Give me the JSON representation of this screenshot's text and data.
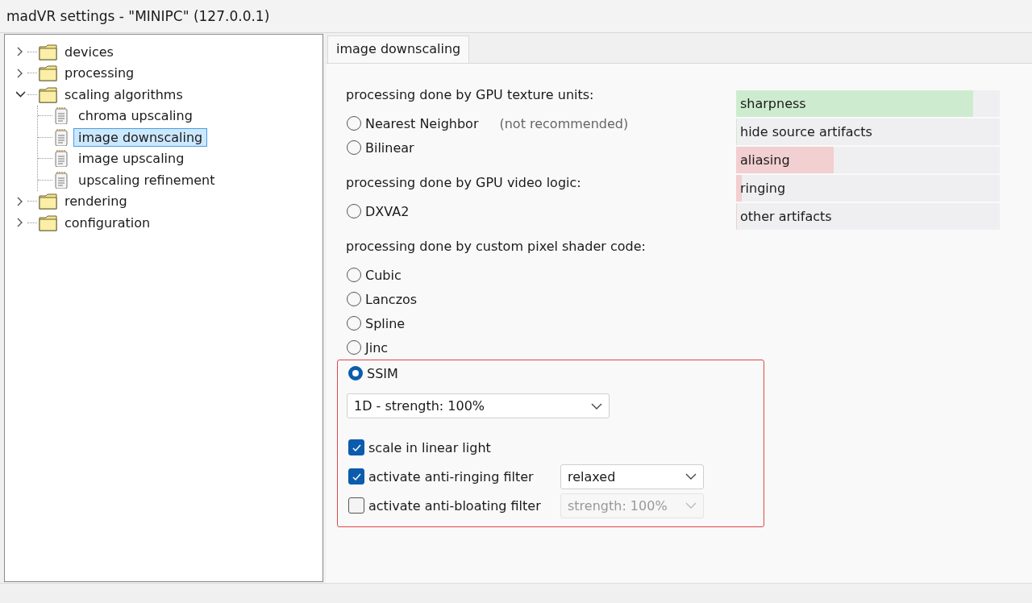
{
  "window": {
    "title": "madVR settings - \"MINIPC\" (127.0.0.1)"
  },
  "tree": [
    {
      "label": "devices",
      "kind": "folder",
      "expanded": false,
      "selected": false
    },
    {
      "label": "processing",
      "kind": "folder",
      "expanded": false,
      "selected": false
    },
    {
      "label": "scaling algorithms",
      "kind": "folder",
      "expanded": true,
      "selected": false,
      "children": [
        {
          "label": "chroma upscaling",
          "kind": "page",
          "selected": false
        },
        {
          "label": "image downscaling",
          "kind": "page",
          "selected": true
        },
        {
          "label": "image upscaling",
          "kind": "page",
          "selected": false
        },
        {
          "label": "upscaling refinement",
          "kind": "page",
          "selected": false
        }
      ]
    },
    {
      "label": "rendering",
      "kind": "folder",
      "expanded": false,
      "selected": false
    },
    {
      "label": "configuration",
      "kind": "folder",
      "expanded": false,
      "selected": false
    }
  ],
  "tabs": [
    {
      "label": "image downscaling",
      "selected": true
    }
  ],
  "groups": [
    {
      "heading": "processing done by GPU texture units:",
      "options": [
        {
          "label": "Nearest Neighbor",
          "note": "(not recommended)",
          "selected": false
        },
        {
          "label": "Bilinear",
          "selected": false
        }
      ]
    },
    {
      "heading": "processing done by GPU video logic:",
      "options": [
        {
          "label": "DXVA2",
          "selected": false
        }
      ]
    },
    {
      "heading": "processing done by custom pixel shader code:",
      "options": [
        {
          "label": "Cubic",
          "selected": false
        },
        {
          "label": "Lanczos",
          "selected": false
        },
        {
          "label": "Spline",
          "selected": false
        },
        {
          "label": "Jinc",
          "selected": false
        }
      ]
    }
  ],
  "ssim": {
    "highlighted": true,
    "option": {
      "label": "SSIM",
      "selected": true
    },
    "mode": {
      "value": "1D - strength: 100%"
    },
    "checkboxes": [
      {
        "label": "scale in linear light",
        "checked": true
      },
      {
        "label": "activate anti-ringing filter",
        "checked": true,
        "dropdown": {
          "value": "relaxed",
          "disabled": false
        }
      },
      {
        "label": "activate anti-bloating filter",
        "checked": false,
        "dropdown": {
          "value": "strength: 100%",
          "disabled": true
        }
      }
    ]
  },
  "meters": [
    {
      "label": "sharpness",
      "level": 0.9,
      "color": "#cdeccf"
    },
    {
      "label": "hide source artifacts",
      "level": 0,
      "color": "#cdeccf"
    },
    {
      "label": "aliasing",
      "level": 0.37,
      "color": "#f2cfd0"
    },
    {
      "label": "ringing",
      "level": 0.02,
      "color": "#f2cfd0"
    },
    {
      "label": "other artifacts",
      "level": 0,
      "color": "#f2cfd0"
    }
  ]
}
